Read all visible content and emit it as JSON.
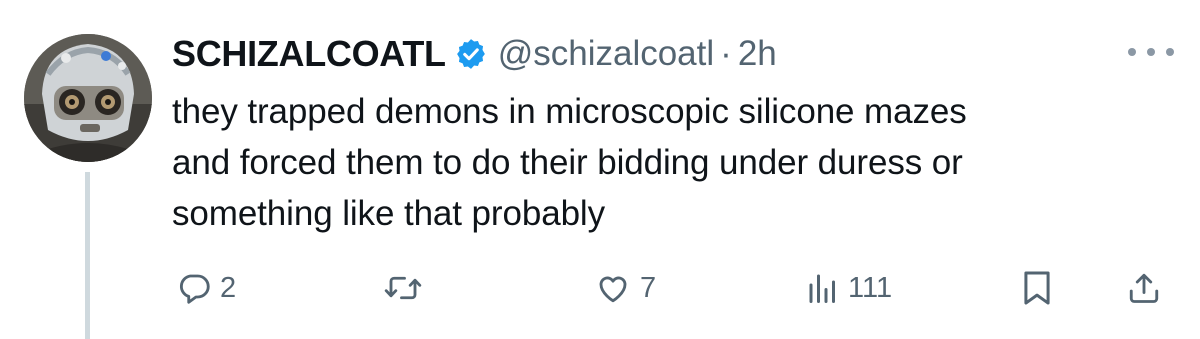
{
  "tweet": {
    "display_name": "SCHIZALCOATL",
    "handle": "@schizalcoatl",
    "separator": "·",
    "time": "2h",
    "body_lines": [
      "they trapped demons in microscopic silicone mazes",
      "and forced them to do their bidding under duress or",
      "something like that probably"
    ],
    "verified_color": "#1d9bf0"
  },
  "actions": {
    "replies": "2",
    "reposts": "",
    "likes": "7",
    "views": "111"
  },
  "icons": {
    "avatar": "robot-avatar",
    "verified": "verified-badge-icon",
    "more": "more-icon",
    "reply": "reply-icon",
    "repost": "repost-icon",
    "like": "like-icon",
    "views": "views-icon",
    "bookmark": "bookmark-icon",
    "share": "share-icon"
  },
  "colors": {
    "text": "#0f1419",
    "secondary": "#536471",
    "thread_line": "#cfd9de"
  }
}
